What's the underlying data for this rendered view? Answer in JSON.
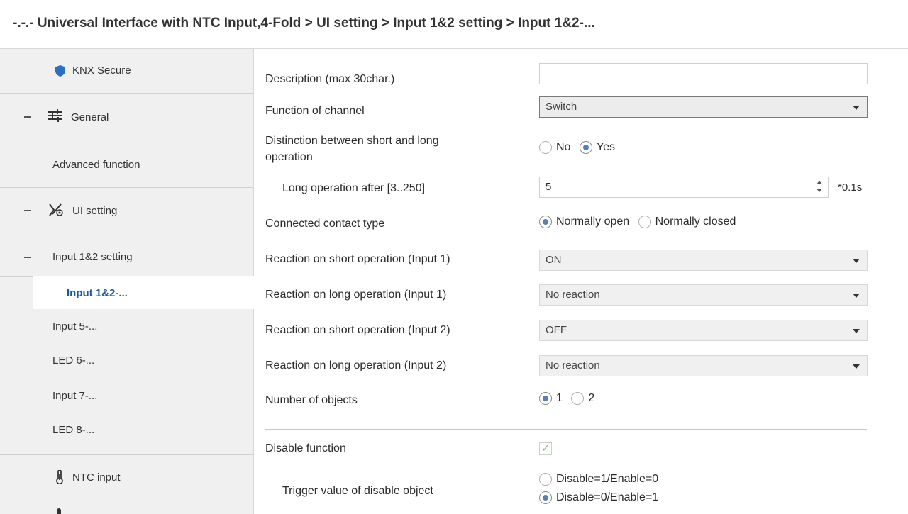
{
  "window": {
    "title": "-.-.- Universal Interface with NTC Input,4-Fold > UI setting > Input 1&2 setting > Input 1&2-..."
  },
  "sidebar": {
    "items": [
      {
        "label": "KNX Secure",
        "icon": "shield-icon"
      },
      {
        "label": "General",
        "icon": "sliders-icon",
        "expander": "−"
      },
      {
        "label": "Advanced function"
      },
      {
        "label": "UI setting",
        "icon": "ui-setting-icon",
        "expander": "−"
      },
      {
        "label": "Input 1&2 setting",
        "expander": "−"
      },
      {
        "label": "Input 1&2-...",
        "selected": true
      },
      {
        "label": "Input 5-..."
      },
      {
        "label": "LED 6-..."
      },
      {
        "label": "Input 7-..."
      },
      {
        "label": "LED 8-..."
      },
      {
        "label": "NTC input",
        "icon": "thermometer-icon"
      }
    ]
  },
  "form": {
    "description": {
      "label": "Description (max 30char.)",
      "value": ""
    },
    "function_of_channel": {
      "label": "Function of channel",
      "value": "Switch"
    },
    "distinction": {
      "label_line1": "Distinction between short and long",
      "label_line2": "operation",
      "options": [
        "No",
        "Yes"
      ],
      "selected": "Yes"
    },
    "long_operation": {
      "label": "Long operation after [3..250]",
      "value": "5",
      "unit": "*0.1s"
    },
    "contact_type": {
      "label": "Connected contact type",
      "options": [
        "Normally open",
        "Normally closed"
      ],
      "selected": "Normally open"
    },
    "short_in1": {
      "label": "Reaction on short operation (Input 1)",
      "value": "ON"
    },
    "long_in1": {
      "label": "Reaction on long operation (Input 1)",
      "value": "No reaction"
    },
    "short_in2": {
      "label": "Reaction on short operation (Input 2)",
      "value": "OFF"
    },
    "long_in2": {
      "label": "Reaction on long operation (Input 2)",
      "value": "No reaction"
    },
    "num_objects": {
      "label": "Number of objects",
      "options": [
        "1",
        "2"
      ],
      "selected": "1"
    },
    "disable_function": {
      "label": "Disable function",
      "checked": true
    },
    "trigger_value": {
      "label": "Trigger value of disable object",
      "options": [
        "Disable=1/Enable=0",
        "Disable=0/Enable=1"
      ],
      "selected": "Disable=0/Enable=1"
    }
  },
  "colors": {
    "accent": "#1f5a96",
    "radio_dot": "#5b7fb0",
    "check": "#7cbf6a",
    "sidebar_bg": "#f0f0f0"
  }
}
